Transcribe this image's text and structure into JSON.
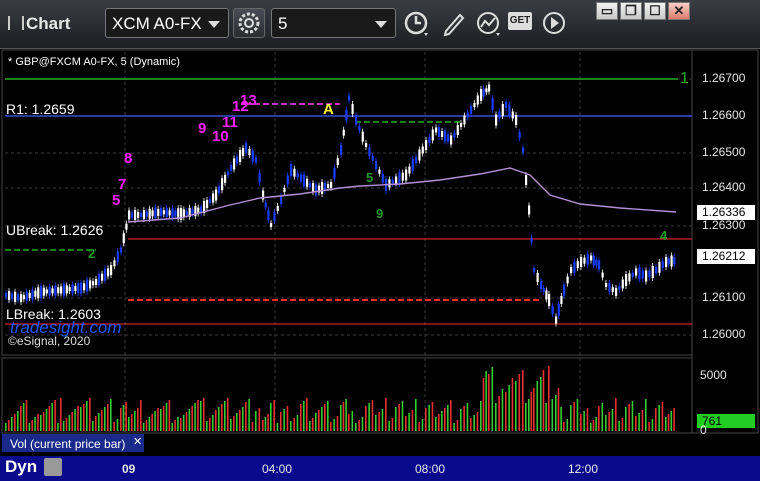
{
  "toolbar": {
    "title": "Chart",
    "symbol": "XCM A0-FX",
    "interval": "5",
    "get_label": "GET"
  },
  "window": {
    "min": "▭",
    "restore": "❐",
    "max": "☐",
    "close": "✕"
  },
  "chart": {
    "legend": "* GBP@FXCM A0-FX, 5 (Dynamic)",
    "r1_label": "R1: 1.2659",
    "ubreak_label": "UBreak: 1.2626",
    "lbreak_label": "LBreak: 1.2603",
    "watermark": "tradesight.com",
    "copyright": "©eSignal, 2020",
    "price_ticks": [
      "1.26700",
      "1.26600",
      "1.26500",
      "1.26400",
      "1.26300",
      "1.26100",
      "1.26000"
    ],
    "last_price": "1.26212",
    "ma_price": "1.26336",
    "time_ticks": [
      "09",
      "04:00",
      "08:00",
      "12:00"
    ],
    "count_labels": [
      "5",
      "7",
      "8",
      "9",
      "10",
      "11",
      "12",
      "13"
    ],
    "count_marker": "A",
    "green_counts": [
      "5",
      "9",
      "4",
      "2"
    ],
    "colors": {
      "up_candle": "#ffffff",
      "down_candle": "#1a3cff",
      "ma": "#b58fd6",
      "r1_line": "#3a4fd6",
      "ubreak": "#ff2a2a",
      "lbreak": "#ff2a2a",
      "top_line": "#22aa22",
      "count": "#ff22ff",
      "count_marker": "#ffff33",
      "green_count": "#1f9a2a"
    }
  },
  "volume": {
    "label": "Vol (current price bar)",
    "ticks": [
      "5000",
      "0"
    ],
    "last_value": "761"
  },
  "footer": {
    "dyn": "Dyn"
  }
}
